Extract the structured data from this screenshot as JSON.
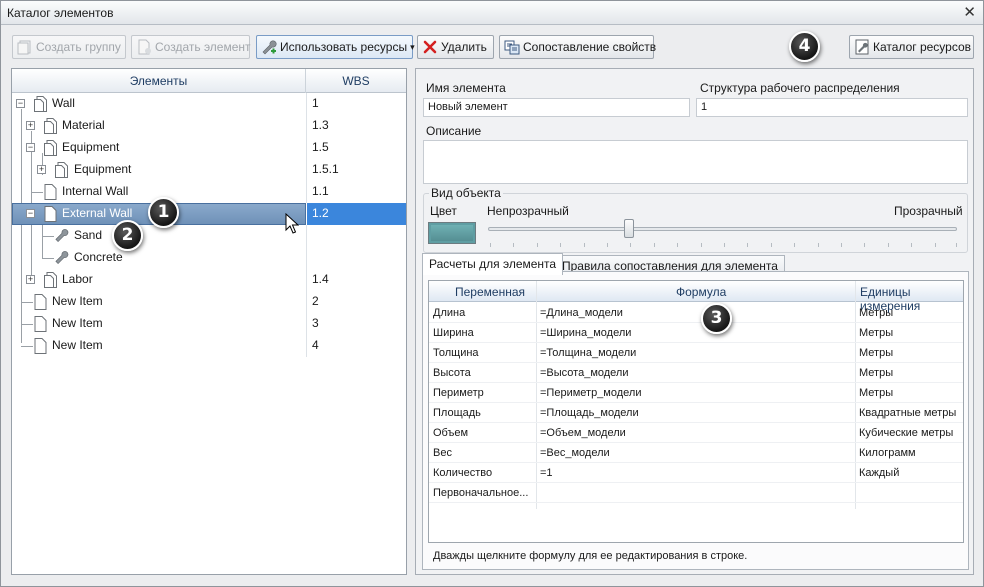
{
  "window": {
    "title": "Каталог элементов",
    "close_glyph": "✕"
  },
  "toolbar": {
    "create_group": "Создать группу",
    "create_element": "Создать элемент",
    "use_resources": "Использовать ресурсы",
    "delete": "Удалить",
    "map_properties": "Сопоставление свойств",
    "resource_catalog": "Каталог ресурсов",
    "caret": "▾"
  },
  "tree": {
    "headers": {
      "elements": "Элементы",
      "wbs": "WBS"
    },
    "rows": [
      {
        "label": "Wall",
        "wbs": "1",
        "expander": "−"
      },
      {
        "label": "Material",
        "wbs": "1.3",
        "expander": "+"
      },
      {
        "label": "Equipment",
        "wbs": "1.5",
        "expander": "−"
      },
      {
        "label": "Equipment",
        "wbs": "1.5.1",
        "expander": "+"
      },
      {
        "label": "Internal Wall",
        "wbs": "1.1",
        "expander": ""
      },
      {
        "label": "External Wall",
        "wbs": "1.2",
        "expander": "−",
        "selected": true
      },
      {
        "label": "Sand",
        "wbs": "",
        "expander": ""
      },
      {
        "label": "Concrete",
        "wbs": "",
        "expander": ""
      },
      {
        "label": "Labor",
        "wbs": "1.4",
        "expander": "+"
      },
      {
        "label": "New Item",
        "wbs": "2",
        "expander": ""
      },
      {
        "label": "New Item",
        "wbs": "3",
        "expander": ""
      },
      {
        "label": "New Item",
        "wbs": "4",
        "expander": ""
      }
    ]
  },
  "details": {
    "name_label": "Имя элемента",
    "name_value": "Новый элемент",
    "wbs_label": "Структура рабочего распределения",
    "wbs_value": "1",
    "description_label": "Описание",
    "description_value": "",
    "appearance": {
      "group_label": "Вид объекта",
      "color_label": "Цвет",
      "opaque_label": "Непрозрачный",
      "transparent_label": "Прозрачный",
      "color": "#5f9ea3",
      "transparency": 0.3
    }
  },
  "tabs": [
    {
      "label": "Расчеты для элемента",
      "selected": true
    },
    {
      "label": "Правила сопоставления для элемента",
      "selected": false
    }
  ],
  "grid": {
    "headers": {
      "variable": "Переменная",
      "formula": "Формула",
      "units": "Единицы измерения"
    },
    "rows": [
      {
        "variable": "Длина",
        "formula": "=Длина_модели",
        "units": "Метры"
      },
      {
        "variable": "Ширина",
        "formula": "=Ширина_модели",
        "units": "Метры"
      },
      {
        "variable": "Толщина",
        "formula": "=Толщина_модели",
        "units": "Метры"
      },
      {
        "variable": "Высота",
        "formula": "=Высота_модели",
        "units": "Метры"
      },
      {
        "variable": "Периметр",
        "formula": "=Периметр_модели",
        "units": "Метры"
      },
      {
        "variable": "Площадь",
        "formula": "=Площадь_модели",
        "units": "Квадратные метры"
      },
      {
        "variable": "Объем",
        "formula": "=Объем_модели",
        "units": "Кубические метры"
      },
      {
        "variable": "Вес",
        "formula": "=Вес_модели",
        "units": "Килограмм"
      },
      {
        "variable": "Количество",
        "formula": "=1",
        "units": "Каждый"
      },
      {
        "variable": "Первоначальное...",
        "formula": "",
        "units": ""
      }
    ],
    "hint": "Дважды щелкните формулу для ее редактирования в строке."
  },
  "callouts": [
    "1",
    "2",
    "3",
    "4"
  ],
  "icons": {
    "doc": "document-icon",
    "wrench": "wrench-icon",
    "delete": "red-x-icon"
  }
}
